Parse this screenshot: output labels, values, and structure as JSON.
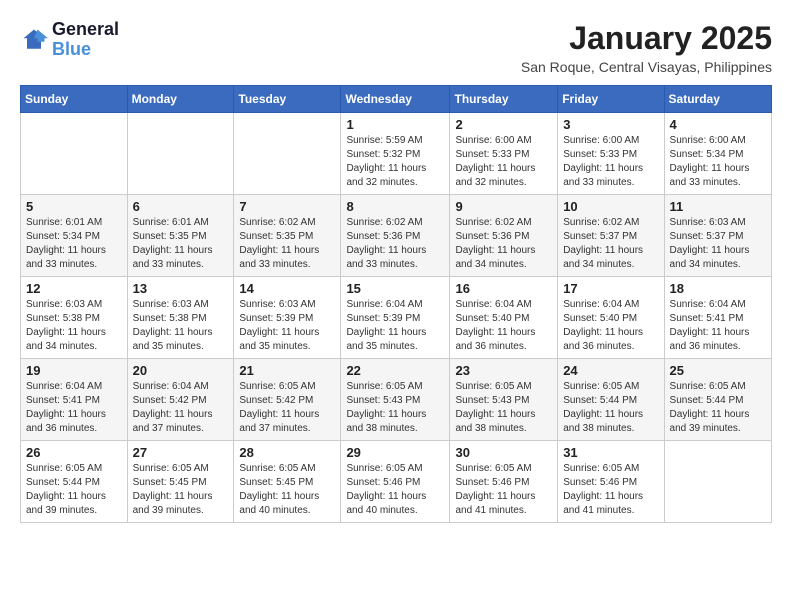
{
  "logo": {
    "line1": "General",
    "line2": "Blue"
  },
  "title": "January 2025",
  "location": "San Roque, Central Visayas, Philippines",
  "weekdays": [
    "Sunday",
    "Monday",
    "Tuesday",
    "Wednesday",
    "Thursday",
    "Friday",
    "Saturday"
  ],
  "weeks": [
    [
      {
        "day": "",
        "info": ""
      },
      {
        "day": "",
        "info": ""
      },
      {
        "day": "",
        "info": ""
      },
      {
        "day": "1",
        "info": "Sunrise: 5:59 AM\nSunset: 5:32 PM\nDaylight: 11 hours\nand 32 minutes."
      },
      {
        "day": "2",
        "info": "Sunrise: 6:00 AM\nSunset: 5:33 PM\nDaylight: 11 hours\nand 32 minutes."
      },
      {
        "day": "3",
        "info": "Sunrise: 6:00 AM\nSunset: 5:33 PM\nDaylight: 11 hours\nand 33 minutes."
      },
      {
        "day": "4",
        "info": "Sunrise: 6:00 AM\nSunset: 5:34 PM\nDaylight: 11 hours\nand 33 minutes."
      }
    ],
    [
      {
        "day": "5",
        "info": "Sunrise: 6:01 AM\nSunset: 5:34 PM\nDaylight: 11 hours\nand 33 minutes."
      },
      {
        "day": "6",
        "info": "Sunrise: 6:01 AM\nSunset: 5:35 PM\nDaylight: 11 hours\nand 33 minutes."
      },
      {
        "day": "7",
        "info": "Sunrise: 6:02 AM\nSunset: 5:35 PM\nDaylight: 11 hours\nand 33 minutes."
      },
      {
        "day": "8",
        "info": "Sunrise: 6:02 AM\nSunset: 5:36 PM\nDaylight: 11 hours\nand 33 minutes."
      },
      {
        "day": "9",
        "info": "Sunrise: 6:02 AM\nSunset: 5:36 PM\nDaylight: 11 hours\nand 34 minutes."
      },
      {
        "day": "10",
        "info": "Sunrise: 6:02 AM\nSunset: 5:37 PM\nDaylight: 11 hours\nand 34 minutes."
      },
      {
        "day": "11",
        "info": "Sunrise: 6:03 AM\nSunset: 5:37 PM\nDaylight: 11 hours\nand 34 minutes."
      }
    ],
    [
      {
        "day": "12",
        "info": "Sunrise: 6:03 AM\nSunset: 5:38 PM\nDaylight: 11 hours\nand 34 minutes."
      },
      {
        "day": "13",
        "info": "Sunrise: 6:03 AM\nSunset: 5:38 PM\nDaylight: 11 hours\nand 35 minutes."
      },
      {
        "day": "14",
        "info": "Sunrise: 6:03 AM\nSunset: 5:39 PM\nDaylight: 11 hours\nand 35 minutes."
      },
      {
        "day": "15",
        "info": "Sunrise: 6:04 AM\nSunset: 5:39 PM\nDaylight: 11 hours\nand 35 minutes."
      },
      {
        "day": "16",
        "info": "Sunrise: 6:04 AM\nSunset: 5:40 PM\nDaylight: 11 hours\nand 36 minutes."
      },
      {
        "day": "17",
        "info": "Sunrise: 6:04 AM\nSunset: 5:40 PM\nDaylight: 11 hours\nand 36 minutes."
      },
      {
        "day": "18",
        "info": "Sunrise: 6:04 AM\nSunset: 5:41 PM\nDaylight: 11 hours\nand 36 minutes."
      }
    ],
    [
      {
        "day": "19",
        "info": "Sunrise: 6:04 AM\nSunset: 5:41 PM\nDaylight: 11 hours\nand 36 minutes."
      },
      {
        "day": "20",
        "info": "Sunrise: 6:04 AM\nSunset: 5:42 PM\nDaylight: 11 hours\nand 37 minutes."
      },
      {
        "day": "21",
        "info": "Sunrise: 6:05 AM\nSunset: 5:42 PM\nDaylight: 11 hours\nand 37 minutes."
      },
      {
        "day": "22",
        "info": "Sunrise: 6:05 AM\nSunset: 5:43 PM\nDaylight: 11 hours\nand 38 minutes."
      },
      {
        "day": "23",
        "info": "Sunrise: 6:05 AM\nSunset: 5:43 PM\nDaylight: 11 hours\nand 38 minutes."
      },
      {
        "day": "24",
        "info": "Sunrise: 6:05 AM\nSunset: 5:44 PM\nDaylight: 11 hours\nand 38 minutes."
      },
      {
        "day": "25",
        "info": "Sunrise: 6:05 AM\nSunset: 5:44 PM\nDaylight: 11 hours\nand 39 minutes."
      }
    ],
    [
      {
        "day": "26",
        "info": "Sunrise: 6:05 AM\nSunset: 5:44 PM\nDaylight: 11 hours\nand 39 minutes."
      },
      {
        "day": "27",
        "info": "Sunrise: 6:05 AM\nSunset: 5:45 PM\nDaylight: 11 hours\nand 39 minutes."
      },
      {
        "day": "28",
        "info": "Sunrise: 6:05 AM\nSunset: 5:45 PM\nDaylight: 11 hours\nand 40 minutes."
      },
      {
        "day": "29",
        "info": "Sunrise: 6:05 AM\nSunset: 5:46 PM\nDaylight: 11 hours\nand 40 minutes."
      },
      {
        "day": "30",
        "info": "Sunrise: 6:05 AM\nSunset: 5:46 PM\nDaylight: 11 hours\nand 41 minutes."
      },
      {
        "day": "31",
        "info": "Sunrise: 6:05 AM\nSunset: 5:46 PM\nDaylight: 11 hours\nand 41 minutes."
      },
      {
        "day": "",
        "info": ""
      }
    ]
  ]
}
